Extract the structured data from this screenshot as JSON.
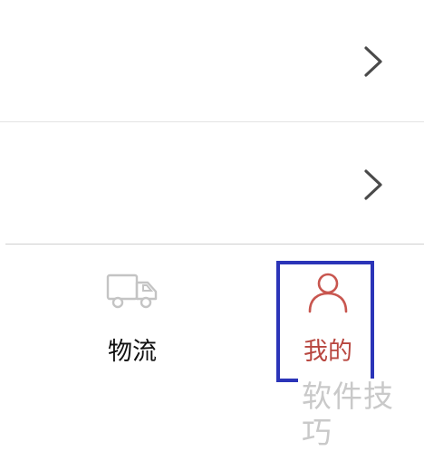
{
  "list": {
    "rows": [
      {
        "chevron_icon": "chevron-right-icon"
      },
      {
        "chevron_icon": "chevron-right-icon"
      }
    ]
  },
  "tabbar": {
    "tabs": [
      {
        "label": "物流",
        "icon": "truck-icon",
        "active": false
      },
      {
        "label": "我的",
        "icon": "person-icon",
        "active": true
      }
    ],
    "active_color": "#b8463f",
    "inactive_color": "#111111"
  },
  "annotation": {
    "highlight_color": "#2b34b8"
  },
  "watermark": {
    "text": "软件技巧"
  }
}
